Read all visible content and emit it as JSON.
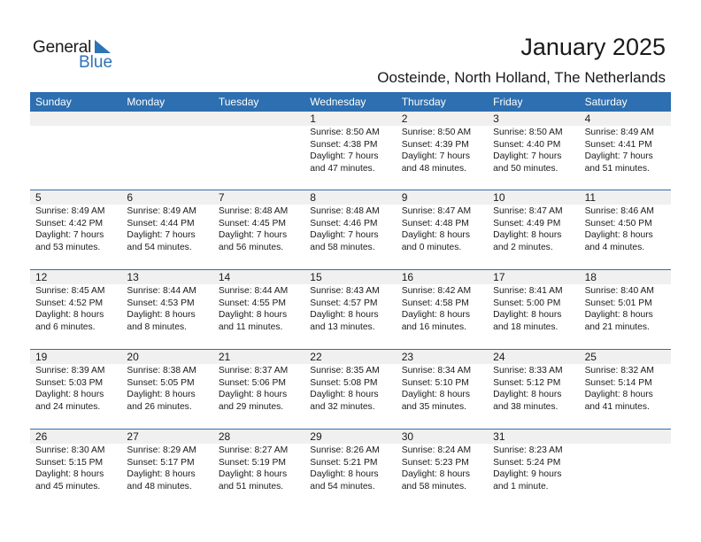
{
  "logo": {
    "general": "General",
    "blue": "Blue"
  },
  "header": {
    "title": "January 2025",
    "location": "Oosteinde, North Holland, The Netherlands"
  },
  "colors": {
    "accent": "#2d6fb0",
    "day_row_bg": "#f0f0f0"
  },
  "weekdays": [
    "Sunday",
    "Monday",
    "Tuesday",
    "Wednesday",
    "Thursday",
    "Friday",
    "Saturday"
  ],
  "weeks": [
    [
      null,
      null,
      null,
      {
        "day": "1",
        "sunrise": "Sunrise: 8:50 AM",
        "sunset": "Sunset: 4:38 PM",
        "daylight1": "Daylight: 7 hours",
        "daylight2": "and 47 minutes."
      },
      {
        "day": "2",
        "sunrise": "Sunrise: 8:50 AM",
        "sunset": "Sunset: 4:39 PM",
        "daylight1": "Daylight: 7 hours",
        "daylight2": "and 48 minutes."
      },
      {
        "day": "3",
        "sunrise": "Sunrise: 8:50 AM",
        "sunset": "Sunset: 4:40 PM",
        "daylight1": "Daylight: 7 hours",
        "daylight2": "and 50 minutes."
      },
      {
        "day": "4",
        "sunrise": "Sunrise: 8:49 AM",
        "sunset": "Sunset: 4:41 PM",
        "daylight1": "Daylight: 7 hours",
        "daylight2": "and 51 minutes."
      }
    ],
    [
      {
        "day": "5",
        "sunrise": "Sunrise: 8:49 AM",
        "sunset": "Sunset: 4:42 PM",
        "daylight1": "Daylight: 7 hours",
        "daylight2": "and 53 minutes."
      },
      {
        "day": "6",
        "sunrise": "Sunrise: 8:49 AM",
        "sunset": "Sunset: 4:44 PM",
        "daylight1": "Daylight: 7 hours",
        "daylight2": "and 54 minutes."
      },
      {
        "day": "7",
        "sunrise": "Sunrise: 8:48 AM",
        "sunset": "Sunset: 4:45 PM",
        "daylight1": "Daylight: 7 hours",
        "daylight2": "and 56 minutes."
      },
      {
        "day": "8",
        "sunrise": "Sunrise: 8:48 AM",
        "sunset": "Sunset: 4:46 PM",
        "daylight1": "Daylight: 7 hours",
        "daylight2": "and 58 minutes."
      },
      {
        "day": "9",
        "sunrise": "Sunrise: 8:47 AM",
        "sunset": "Sunset: 4:48 PM",
        "daylight1": "Daylight: 8 hours",
        "daylight2": "and 0 minutes."
      },
      {
        "day": "10",
        "sunrise": "Sunrise: 8:47 AM",
        "sunset": "Sunset: 4:49 PM",
        "daylight1": "Daylight: 8 hours",
        "daylight2": "and 2 minutes."
      },
      {
        "day": "11",
        "sunrise": "Sunrise: 8:46 AM",
        "sunset": "Sunset: 4:50 PM",
        "daylight1": "Daylight: 8 hours",
        "daylight2": "and 4 minutes."
      }
    ],
    [
      {
        "day": "12",
        "sunrise": "Sunrise: 8:45 AM",
        "sunset": "Sunset: 4:52 PM",
        "daylight1": "Daylight: 8 hours",
        "daylight2": "and 6 minutes."
      },
      {
        "day": "13",
        "sunrise": "Sunrise: 8:44 AM",
        "sunset": "Sunset: 4:53 PM",
        "daylight1": "Daylight: 8 hours",
        "daylight2": "and 8 minutes."
      },
      {
        "day": "14",
        "sunrise": "Sunrise: 8:44 AM",
        "sunset": "Sunset: 4:55 PM",
        "daylight1": "Daylight: 8 hours",
        "daylight2": "and 11 minutes."
      },
      {
        "day": "15",
        "sunrise": "Sunrise: 8:43 AM",
        "sunset": "Sunset: 4:57 PM",
        "daylight1": "Daylight: 8 hours",
        "daylight2": "and 13 minutes."
      },
      {
        "day": "16",
        "sunrise": "Sunrise: 8:42 AM",
        "sunset": "Sunset: 4:58 PM",
        "daylight1": "Daylight: 8 hours",
        "daylight2": "and 16 minutes."
      },
      {
        "day": "17",
        "sunrise": "Sunrise: 8:41 AM",
        "sunset": "Sunset: 5:00 PM",
        "daylight1": "Daylight: 8 hours",
        "daylight2": "and 18 minutes."
      },
      {
        "day": "18",
        "sunrise": "Sunrise: 8:40 AM",
        "sunset": "Sunset: 5:01 PM",
        "daylight1": "Daylight: 8 hours",
        "daylight2": "and 21 minutes."
      }
    ],
    [
      {
        "day": "19",
        "sunrise": "Sunrise: 8:39 AM",
        "sunset": "Sunset: 5:03 PM",
        "daylight1": "Daylight: 8 hours",
        "daylight2": "and 24 minutes."
      },
      {
        "day": "20",
        "sunrise": "Sunrise: 8:38 AM",
        "sunset": "Sunset: 5:05 PM",
        "daylight1": "Daylight: 8 hours",
        "daylight2": "and 26 minutes."
      },
      {
        "day": "21",
        "sunrise": "Sunrise: 8:37 AM",
        "sunset": "Sunset: 5:06 PM",
        "daylight1": "Daylight: 8 hours",
        "daylight2": "and 29 minutes."
      },
      {
        "day": "22",
        "sunrise": "Sunrise: 8:35 AM",
        "sunset": "Sunset: 5:08 PM",
        "daylight1": "Daylight: 8 hours",
        "daylight2": "and 32 minutes."
      },
      {
        "day": "23",
        "sunrise": "Sunrise: 8:34 AM",
        "sunset": "Sunset: 5:10 PM",
        "daylight1": "Daylight: 8 hours",
        "daylight2": "and 35 minutes."
      },
      {
        "day": "24",
        "sunrise": "Sunrise: 8:33 AM",
        "sunset": "Sunset: 5:12 PM",
        "daylight1": "Daylight: 8 hours",
        "daylight2": "and 38 minutes."
      },
      {
        "day": "25",
        "sunrise": "Sunrise: 8:32 AM",
        "sunset": "Sunset: 5:14 PM",
        "daylight1": "Daylight: 8 hours",
        "daylight2": "and 41 minutes."
      }
    ],
    [
      {
        "day": "26",
        "sunrise": "Sunrise: 8:30 AM",
        "sunset": "Sunset: 5:15 PM",
        "daylight1": "Daylight: 8 hours",
        "daylight2": "and 45 minutes."
      },
      {
        "day": "27",
        "sunrise": "Sunrise: 8:29 AM",
        "sunset": "Sunset: 5:17 PM",
        "daylight1": "Daylight: 8 hours",
        "daylight2": "and 48 minutes."
      },
      {
        "day": "28",
        "sunrise": "Sunrise: 8:27 AM",
        "sunset": "Sunset: 5:19 PM",
        "daylight1": "Daylight: 8 hours",
        "daylight2": "and 51 minutes."
      },
      {
        "day": "29",
        "sunrise": "Sunrise: 8:26 AM",
        "sunset": "Sunset: 5:21 PM",
        "daylight1": "Daylight: 8 hours",
        "daylight2": "and 54 minutes."
      },
      {
        "day": "30",
        "sunrise": "Sunrise: 8:24 AM",
        "sunset": "Sunset: 5:23 PM",
        "daylight1": "Daylight: 8 hours",
        "daylight2": "and 58 minutes."
      },
      {
        "day": "31",
        "sunrise": "Sunrise: 8:23 AM",
        "sunset": "Sunset: 5:24 PM",
        "daylight1": "Daylight: 9 hours",
        "daylight2": "and 1 minute."
      },
      null
    ]
  ]
}
